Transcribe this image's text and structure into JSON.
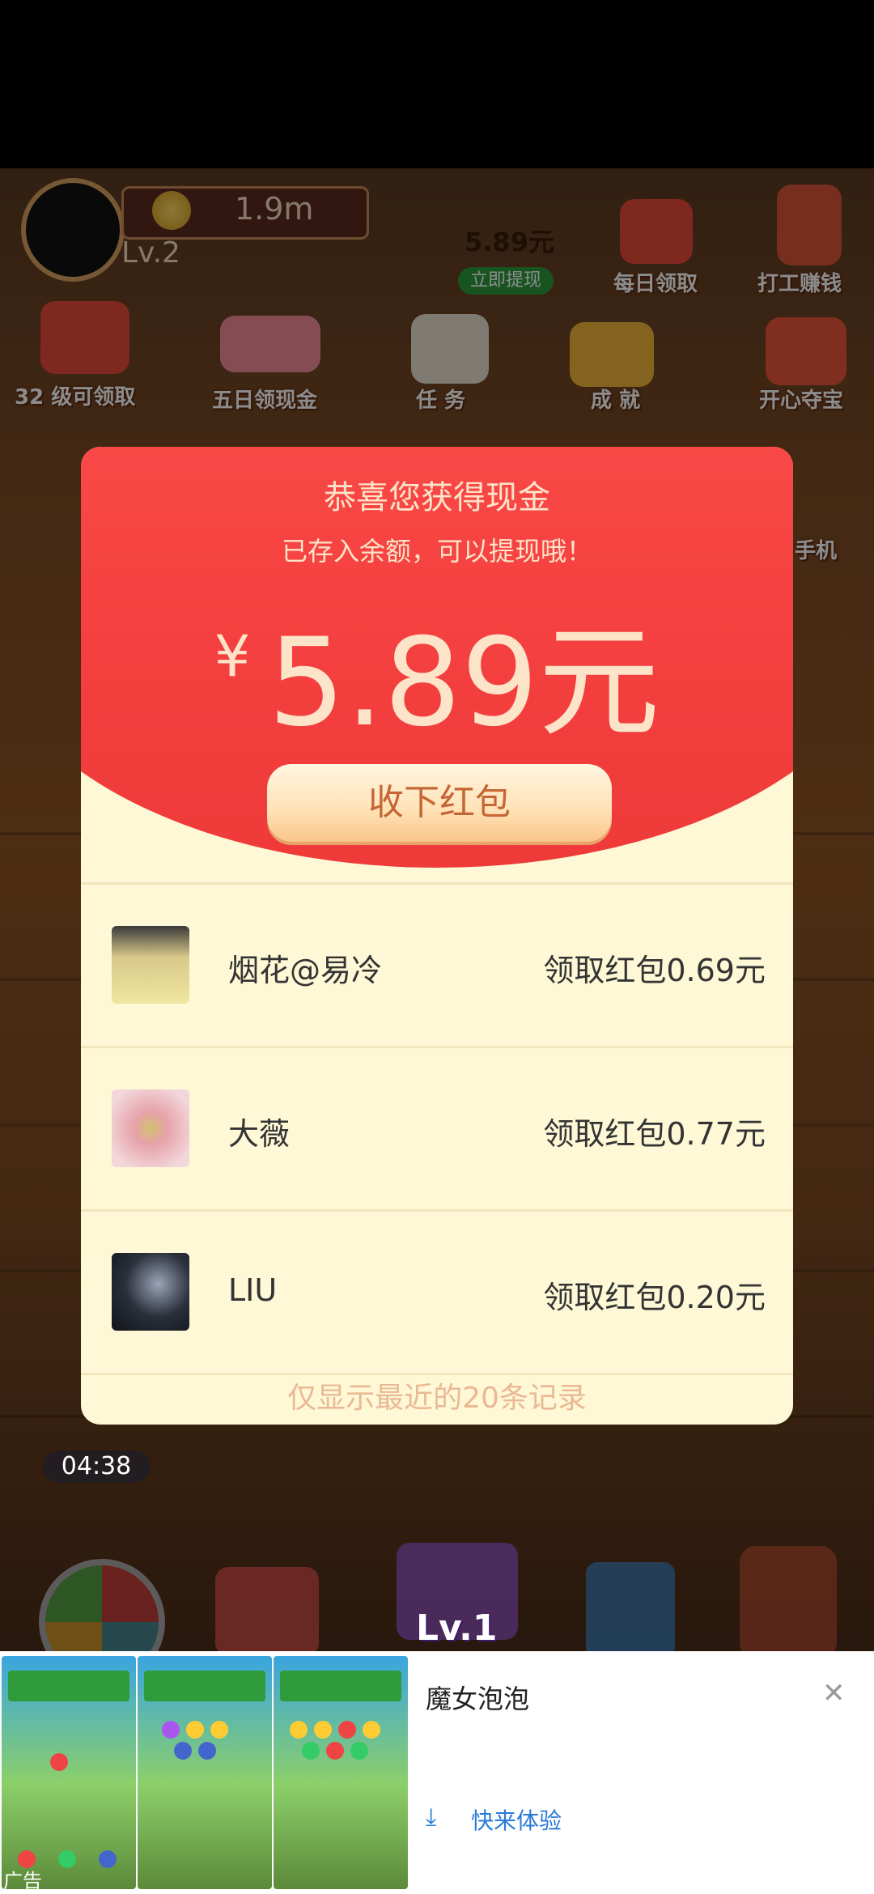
{
  "hud": {
    "coins": "1.9m",
    "level": "Lv.2",
    "balance": "5.89元",
    "withdraw_now": "立即提现",
    "top_icons": [
      {
        "label": "每日领取",
        "icon": "red-envelope-100-icon"
      },
      {
        "label": "打工赚钱",
        "icon": "chef-icon"
      }
    ],
    "mid_icons": [
      {
        "label": "32 级可领取",
        "icon": "red-envelope-icon"
      },
      {
        "label": "五日领现金",
        "icon": "cash-stack-icon"
      },
      {
        "label": "任 务",
        "icon": "clipboard-icon"
      },
      {
        "label": "成 就",
        "icon": "medal-icon"
      },
      {
        "label": "开心夺宝",
        "icon": "treasure-icon"
      }
    ],
    "side_label": "手机",
    "timer": "04:38",
    "bottom_level": "Lv.1"
  },
  "dialog": {
    "title": "恭喜您获得现金",
    "subtitle": "已存入余额，可以提现哦！",
    "currency": "¥",
    "amount": "5.89元",
    "collect_button": "收下红包",
    "records": [
      {
        "name": "烟花@易冷",
        "amount": "领取红包0.69元",
        "avatar_color": "#d8c88a"
      },
      {
        "name": "大薇",
        "amount": "领取红包0.77元",
        "avatar_color": "#e6b0b8"
      },
      {
        "name": "LIU",
        "amount": "领取红包0.20元",
        "avatar_color": "#2a2f3a"
      }
    ],
    "footer": "仅显示最近的20条记录"
  },
  "ad": {
    "title": "魔女泡泡",
    "cta": "快来体验",
    "tag": "广告",
    "close_icon": "close-icon",
    "download_icon": "download-icon"
  }
}
